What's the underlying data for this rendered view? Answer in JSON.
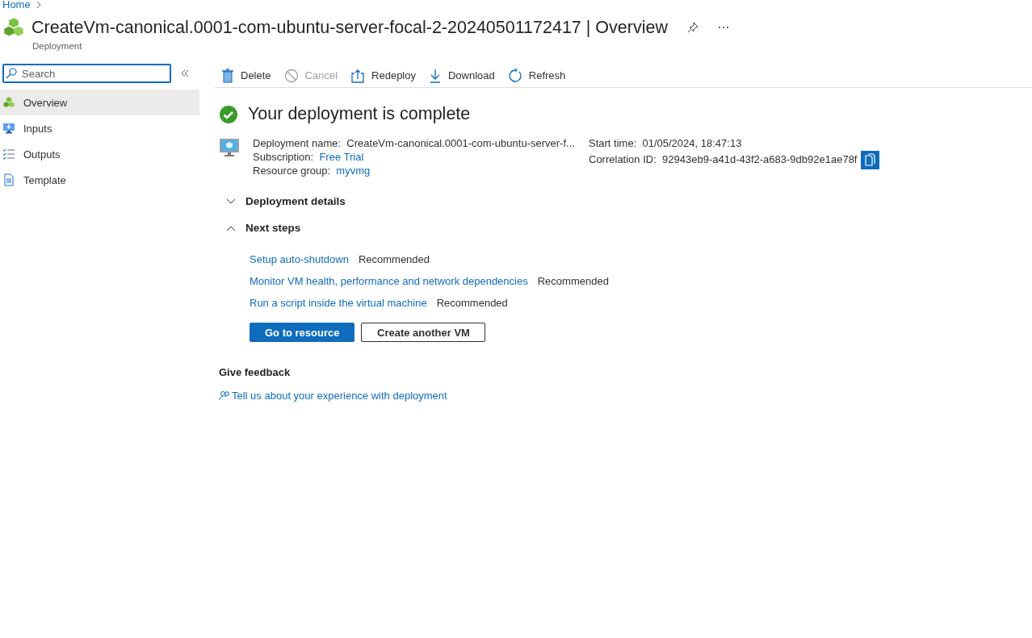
{
  "breadcrumb": [
    {
      "label": "Home"
    }
  ],
  "header": {
    "title": "CreateVm-canonical.0001-com-ubuntu-server-focal-2-20240501172417 | Overview",
    "subtitle": "Deployment"
  },
  "sidebar": {
    "search": {
      "placeholder": "Search"
    },
    "items": [
      {
        "label": "Overview",
        "selected": true
      },
      {
        "label": "Inputs",
        "selected": false
      },
      {
        "label": "Outputs",
        "selected": false
      },
      {
        "label": "Template",
        "selected": false
      }
    ]
  },
  "toolbar": [
    {
      "label": "Delete",
      "disabled": false
    },
    {
      "label": "Cancel",
      "disabled": true
    },
    {
      "label": "Redeploy",
      "disabled": false
    },
    {
      "label": "Download",
      "disabled": false
    },
    {
      "label": "Refresh",
      "disabled": false
    }
  ],
  "status": {
    "title": "Your deployment is complete"
  },
  "details": {
    "left": [
      {
        "label": "Deployment name:",
        "value": "CreateVm-canonical.0001-com-ubuntu-server-f...",
        "kind": "text"
      },
      {
        "label": "Subscription:",
        "value": "Free Trial",
        "kind": "link"
      },
      {
        "label": "Resource group:",
        "value": "myvmg",
        "kind": "link"
      }
    ],
    "right": [
      {
        "label": "Start time:",
        "value": "01/05/2024, 18:47:13",
        "kind": "text"
      },
      {
        "label": "Correlation ID:",
        "value": "92943eb9-a41d-43f2-a683-9db92e1ae78f",
        "kind": "copy"
      }
    ]
  },
  "sections": [
    {
      "title": "Deployment details",
      "expanded": false
    },
    {
      "title": "Next steps",
      "expanded": true,
      "steps": [
        {
          "link": "Setup auto-shutdown",
          "tag": "Recommended"
        },
        {
          "link": "Monitor VM health, performance and network dependencies",
          "tag": "Recommended"
        },
        {
          "link": "Run a script inside the virtual machine",
          "tag": "Recommended"
        }
      ],
      "buttons": [
        {
          "label": "Go to resource",
          "kind": "primary"
        },
        {
          "label": "Create another VM",
          "kind": "secondary"
        }
      ]
    }
  ],
  "feedback": {
    "title": "Give feedback",
    "link": "Tell us about your experience with deployment"
  }
}
